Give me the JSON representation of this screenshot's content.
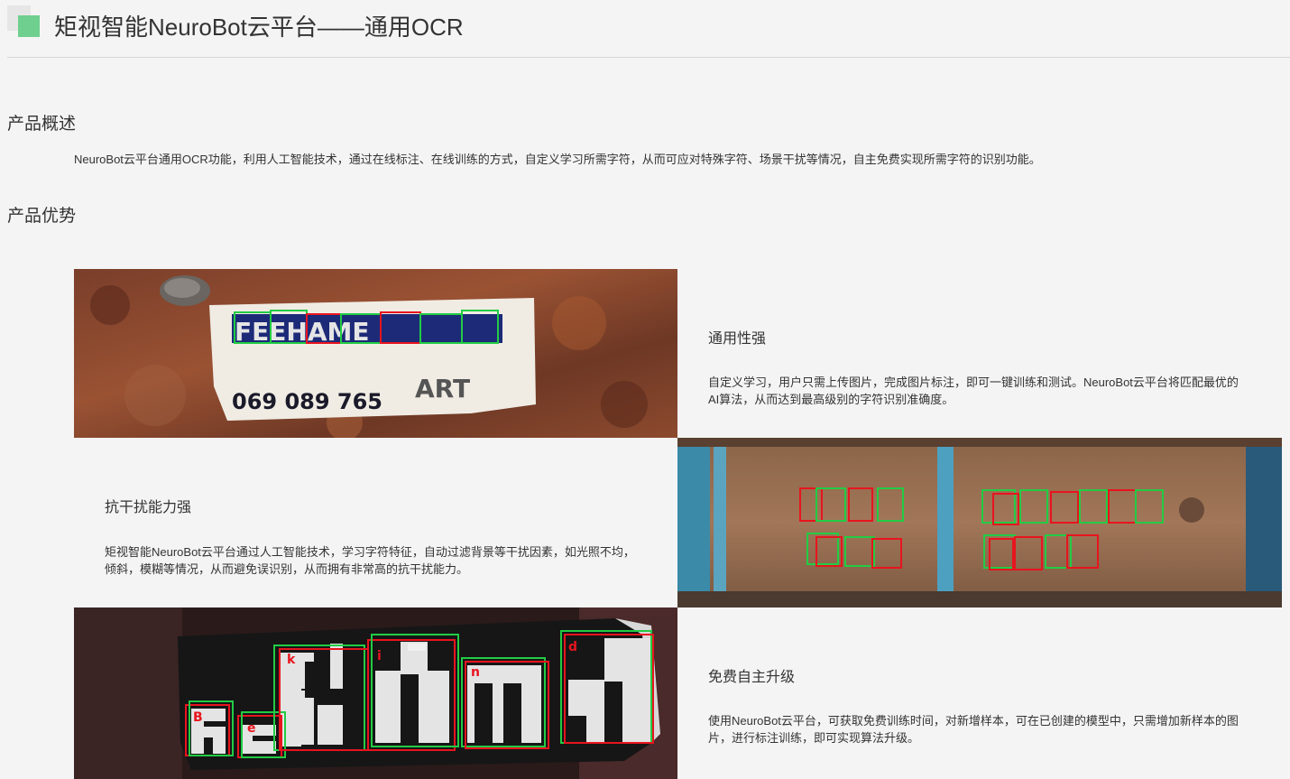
{
  "header": {
    "title": "矩视智能NeuroBot云平台——通用OCR",
    "logo_color": "#6fcf8f"
  },
  "overview": {
    "heading": "产品概述",
    "text": "NeuroBot云平台通用OCR功能，利用人工智能技术，通过在线标注、在线训练的方式，自定义学习所需字符，从而可应对特殊字符、场景干扰等情况，自主免费实现所需字符的识别功能。"
  },
  "advantages": {
    "heading": "产品优势",
    "features": [
      {
        "title": "通用性强",
        "description": "自定义学习，用户只需上传图片，完成图片标注，即可一键训练和测试。NeuroBot云平台将匹配最优的AI算法，从而达到最高级别的字符识别准确度。",
        "image_text": "069 089 765",
        "image_label": "ART"
      },
      {
        "title": "抗干扰能力强",
        "description": "矩视智能NeuroBot云平台通过人工智能技术，学习字符特征，自动过滤背景等干扰因素，如光照不均，倾斜，模糊等情况，从而避免误识别，从而拥有非常高的抗干扰能力。"
      },
      {
        "title": "免费自主升级",
        "description": "使用NeuroBot云平台，可获取免费训练时间，对新增样本，可在已创建的模型中，只需增加新样本的图片，进行标注训练，即可实现算法升级。"
      }
    ]
  },
  "colors": {
    "box_green": "#22cc44",
    "box_red": "#e8141e",
    "rust": "#8a4a30",
    "container": "#9a6a4a",
    "sign": "#2a1a1a"
  }
}
